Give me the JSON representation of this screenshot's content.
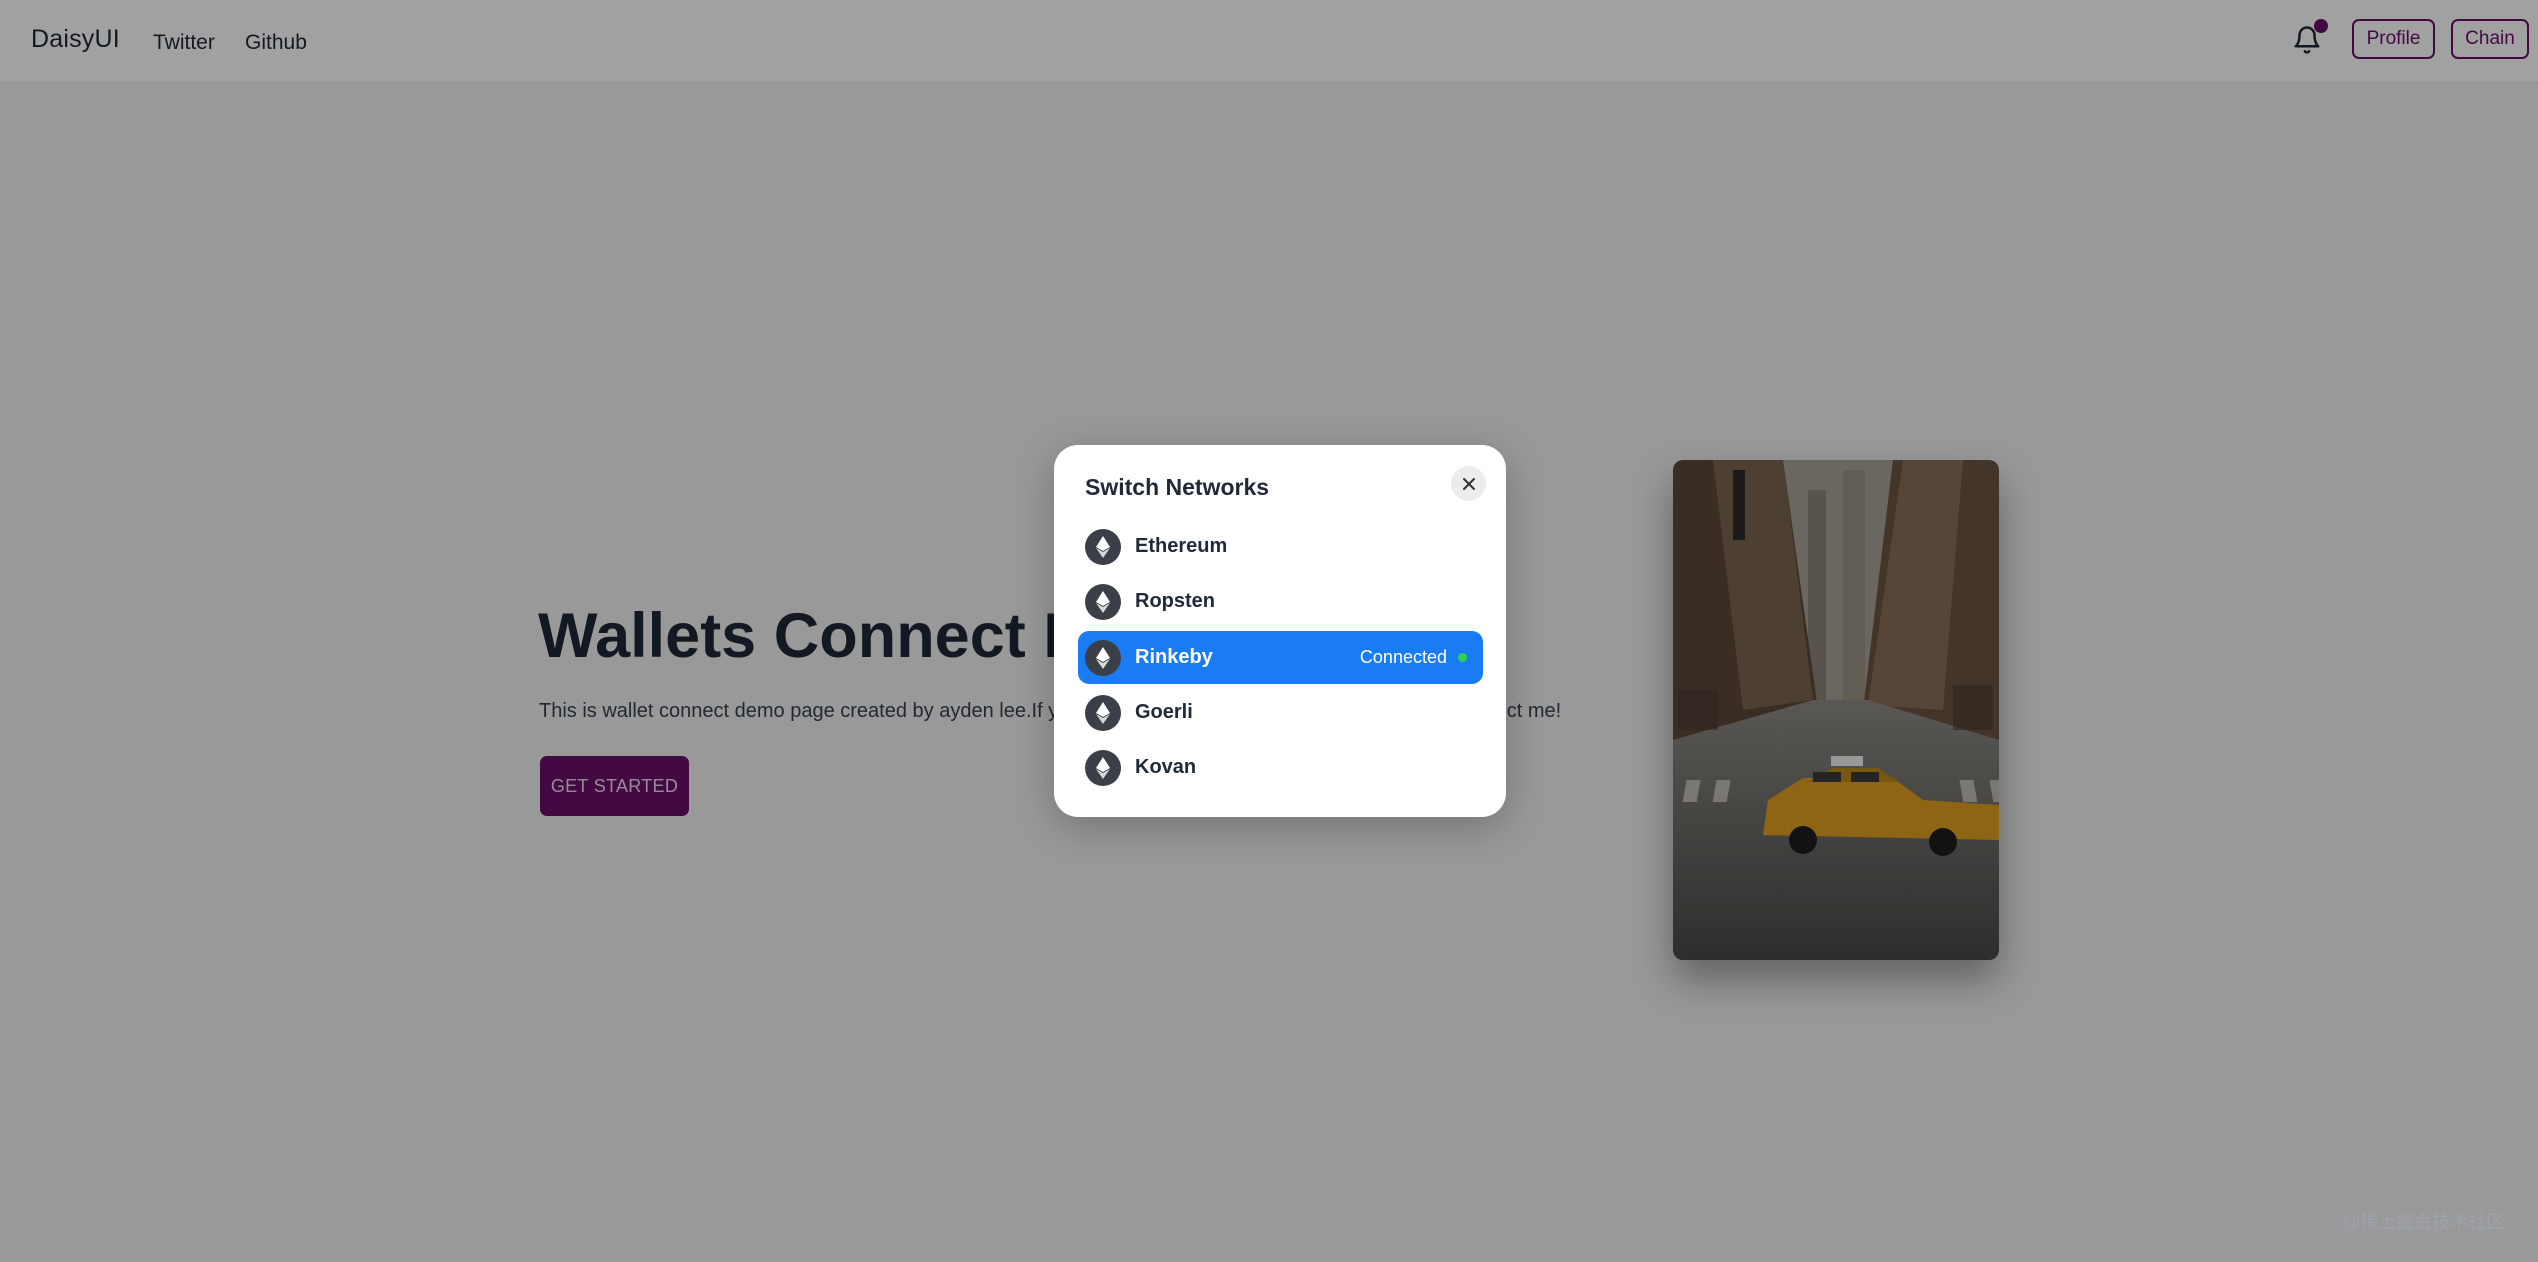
{
  "navbar": {
    "brand": "DaisyUI",
    "links": [
      "Twitter",
      "Github"
    ],
    "profile_label": "Profile",
    "chain_label": "Chain",
    "notification_icon": "bell-icon"
  },
  "hero": {
    "title": "Wallets Connect Demo",
    "description": "This is wallet connect demo page created by ayden lee.If you want to contact with me, don't hesitate to connect me!",
    "cta_label": "GET STARTED"
  },
  "modal": {
    "title": "Switch Networks",
    "close_icon": "close-icon",
    "networks": [
      {
        "label": "Ethereum",
        "active": false
      },
      {
        "label": "Ropsten",
        "active": false
      },
      {
        "label": "Rinkeby",
        "active": true,
        "status": "Connected"
      },
      {
        "label": "Goerli",
        "active": false
      },
      {
        "label": "Kovan",
        "active": false
      }
    ]
  },
  "watermark": "@稀土掘金技术社区",
  "colors": {
    "accent": "#6b0f6b",
    "active_network": "#1a7cf2",
    "connected_dot": "#30d158"
  }
}
